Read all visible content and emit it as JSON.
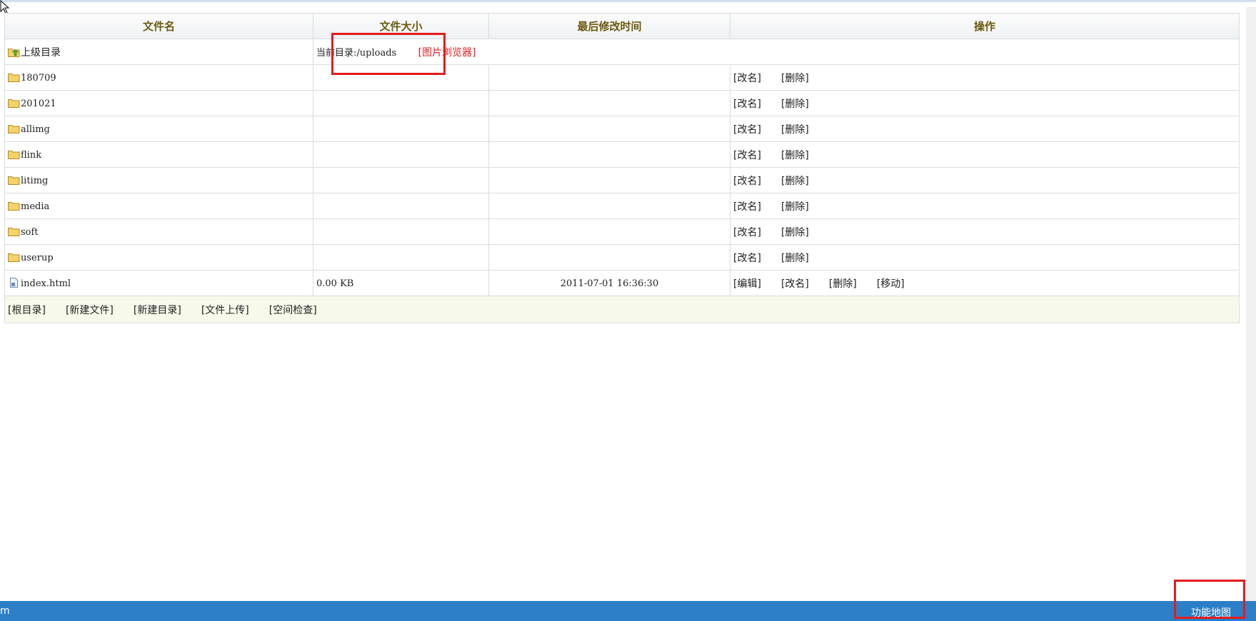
{
  "headers": {
    "name": "文件名",
    "size": "文件大小",
    "mtime": "最后修改时间",
    "ops": "操作"
  },
  "parent_row": {
    "label": "上级目录",
    "current_dir": "当前目录:/uploads",
    "image_browser": "[图片浏览器]"
  },
  "folders": [
    {
      "name": "180709",
      "rename": "[改名]",
      "delete": "[删除]"
    },
    {
      "name": "201021",
      "rename": "[改名]",
      "delete": "[删除]"
    },
    {
      "name": "allimg",
      "rename": "[改名]",
      "delete": "[删除]"
    },
    {
      "name": "flink",
      "rename": "[改名]",
      "delete": "[删除]"
    },
    {
      "name": "litimg",
      "rename": "[改名]",
      "delete": "[删除]"
    },
    {
      "name": "media",
      "rename": "[改名]",
      "delete": "[删除]"
    },
    {
      "name": "soft",
      "rename": "[改名]",
      "delete": "[删除]"
    },
    {
      "name": "userup",
      "rename": "[改名]",
      "delete": "[删除]"
    }
  ],
  "file": {
    "name": "index.html",
    "size": "0.00 KB",
    "mtime": "2011-07-01 16:36:30",
    "edit": "[编辑]",
    "rename": "[改名]",
    "delete": "[删除]",
    "move": "[移动]"
  },
  "footer": {
    "root": "[根目录]",
    "new_file": "[新建文件]",
    "new_dir": "[新建目录]",
    "upload": "[文件上传]",
    "space_check": "[空间检查]"
  },
  "statusbar": {
    "left_text": "m",
    "site_map": "功能地图"
  },
  "colors": {
    "header_text": "#6b5a0f",
    "footer_bg": "#f7f9ea",
    "statusbar_bg": "#2c7ec7",
    "highlight": "#e51b1b",
    "link_red": "#e02020"
  },
  "icons": {
    "folder": "folder-icon",
    "parent": "folder-up-icon",
    "file": "file-icon"
  }
}
